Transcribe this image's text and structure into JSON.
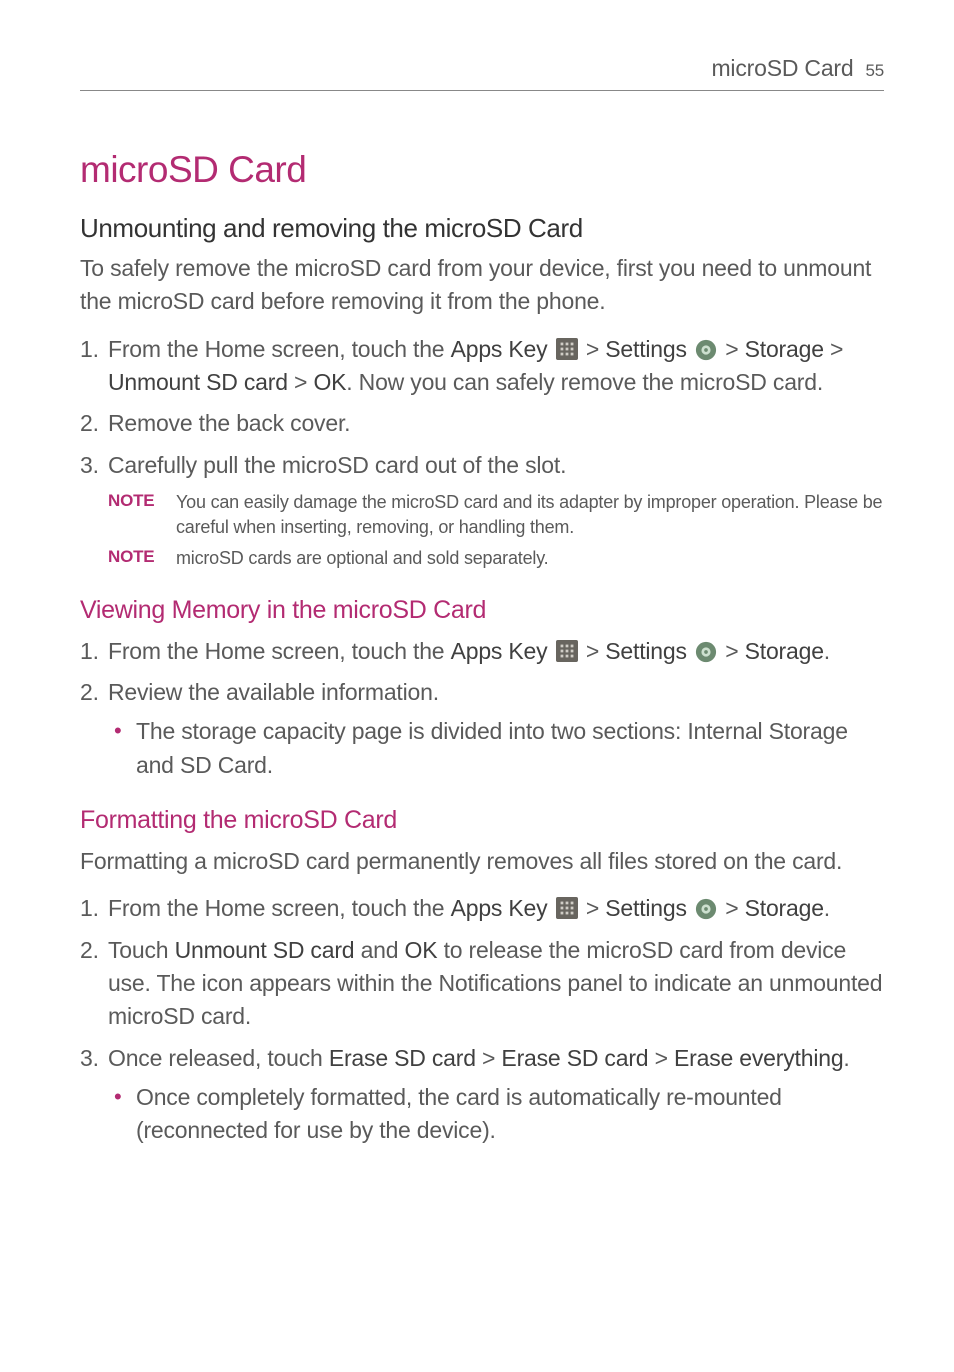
{
  "header": {
    "title": "microSD Card",
    "page": "55"
  },
  "main_title": "microSD Card",
  "section1": {
    "heading": "Unmounting and removing the microSD Card",
    "intro": "To safely remove the microSD card from your device, first you need to unmount the microSD card before removing it from the phone.",
    "steps": {
      "s1a": "From the Home screen, touch the ",
      "s1b_apps": "Apps Key",
      "s1c": " > ",
      "s1d_settings": "Settings",
      "s1e": " > ",
      "s1f_storage": "Storage",
      "s1g": " > ",
      "s1h_unmount": "Unmount SD card",
      "s1i": " > ",
      "s1j_ok": "OK",
      "s1k": ". Now you can safely remove the microSD card.",
      "s2": "Remove the back cover.",
      "s3": "Carefully pull the microSD card out of the slot."
    },
    "note_label": "NOTE",
    "note1": "You can easily damage the microSD card and its adapter by improper operation. Please be careful when inserting, removing, or handling them.",
    "note2": "microSD cards are optional and sold separately."
  },
  "section2": {
    "heading": "Viewing Memory in the microSD Card",
    "steps": {
      "s1a": "From the Home screen, touch the ",
      "s1b_apps": "Apps Key",
      "s1c": " > ",
      "s1d_settings": "Settings",
      "s1e": " > ",
      "s1f_storage": "Storage",
      "s1g": ".",
      "s2": "Review the available information.",
      "bullet1": "The storage capacity page is divided into two sections: Internal Storage and SD Card."
    }
  },
  "section3": {
    "heading": "Formatting the microSD Card",
    "intro": "Formatting a microSD card permanently removes all files stored on the card.",
    "steps": {
      "s1a": "From the Home screen, touch the ",
      "s1b_apps": "Apps Key",
      "s1c": " > ",
      "s1d_settings": "Settings",
      "s1e": " > ",
      "s1f_storage": "Storage",
      "s1g": ".",
      "s2a": "Touch ",
      "s2b_unmount": "Unmount SD card",
      "s2c": " and ",
      "s2d_ok": "OK",
      "s2e": " to release the microSD card from device use. The icon appears within the Notifications panel to indicate an unmounted microSD card.",
      "s3a": "Once released, touch ",
      "s3b": "Erase SD card",
      "s3c": " > ",
      "s3d": "Erase SD card",
      "s3e": " > ",
      "s3f": "Erase everything",
      "s3g": ".",
      "bullet1": "Once completely formatted, the card is automatically re-mounted (reconnected for use by the device)."
    }
  }
}
